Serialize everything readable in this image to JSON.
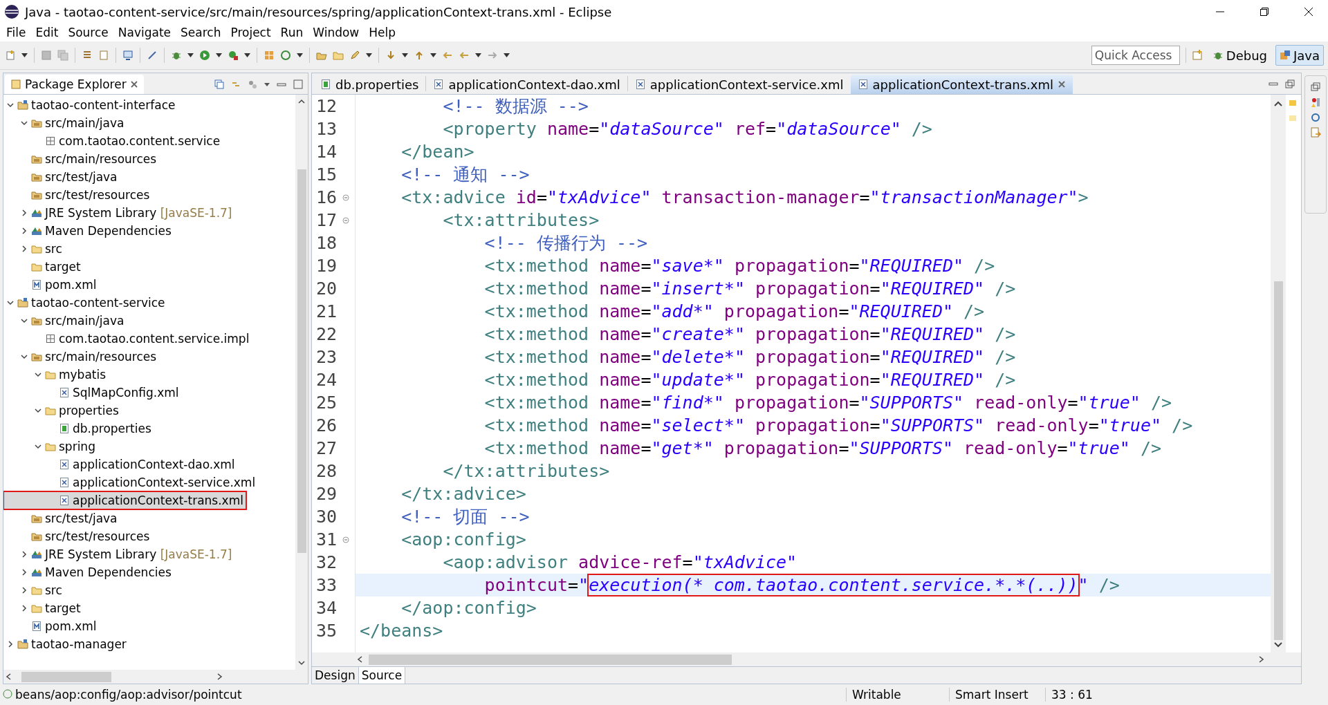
{
  "window": {
    "title": "Java - taotao-content-service/src/main/resources/spring/applicationContext-trans.xml - Eclipse"
  },
  "menu": [
    "File",
    "Edit",
    "Source",
    "Navigate",
    "Search",
    "Project",
    "Run",
    "Window",
    "Help"
  ],
  "quick_access": {
    "placeholder": "Quick Access"
  },
  "perspectives": [
    {
      "label": "Debug",
      "kind": "debug",
      "selected": false
    },
    {
      "label": "Java",
      "kind": "java",
      "selected": true
    }
  ],
  "package_explorer": {
    "title": "Package Explorer",
    "tree": [
      {
        "label": "taotao-content-interface",
        "kind": "project",
        "expanded": true,
        "selected": false,
        "children": [
          {
            "label": "src/main/java",
            "kind": "source",
            "expanded": true,
            "selected": false,
            "children": [
              {
                "label": "com.taotao.content.service",
                "kind": "package",
                "selected": false
              }
            ]
          },
          {
            "label": "src/main/resources",
            "kind": "source",
            "selected": false
          },
          {
            "label": "src/test/java",
            "kind": "source",
            "selected": false
          },
          {
            "label": "src/test/resources",
            "kind": "source",
            "selected": false
          },
          {
            "label": "JRE System Library",
            "decoration": "[JavaSE-1.7]",
            "kind": "library",
            "expanded": false,
            "selected": false
          },
          {
            "label": "Maven Dependencies",
            "kind": "library",
            "expanded": false,
            "selected": false
          },
          {
            "label": "src",
            "kind": "folder",
            "expanded": false,
            "selected": false
          },
          {
            "label": "target",
            "kind": "folder",
            "selected": false
          },
          {
            "label": "pom.xml",
            "kind": "pom",
            "selected": false
          }
        ]
      },
      {
        "label": "taotao-content-service",
        "kind": "project",
        "expanded": true,
        "selected": false,
        "children": [
          {
            "label": "src/main/java",
            "kind": "source",
            "expanded": true,
            "selected": false,
            "children": [
              {
                "label": "com.taotao.content.service.impl",
                "kind": "package",
                "selected": false
              }
            ]
          },
          {
            "label": "src/main/resources",
            "kind": "source",
            "expanded": true,
            "selected": false,
            "children": [
              {
                "label": "mybatis",
                "kind": "folder",
                "expanded": true,
                "selected": false,
                "children": [
                  {
                    "label": "SqlMapConfig.xml",
                    "kind": "xml",
                    "selected": false
                  }
                ]
              },
              {
                "label": "properties",
                "kind": "folder",
                "expanded": true,
                "selected": false,
                "children": [
                  {
                    "label": "db.properties",
                    "kind": "properties",
                    "selected": false
                  }
                ]
              },
              {
                "label": "spring",
                "kind": "folder",
                "expanded": true,
                "selected": false,
                "children": [
                  {
                    "label": "applicationContext-dao.xml",
                    "kind": "xml",
                    "selected": false
                  },
                  {
                    "label": "applicationContext-service.xml",
                    "kind": "xml",
                    "selected": false
                  },
                  {
                    "label": "applicationContext-trans.xml",
                    "kind": "xml",
                    "selected": true
                  }
                ]
              }
            ]
          },
          {
            "label": "src/test/java",
            "kind": "source",
            "selected": false
          },
          {
            "label": "src/test/resources",
            "kind": "source",
            "selected": false
          },
          {
            "label": "JRE System Library",
            "decoration": "[JavaSE-1.7]",
            "kind": "library",
            "expanded": false,
            "selected": false
          },
          {
            "label": "Maven Dependencies",
            "kind": "library",
            "expanded": false,
            "selected": false
          },
          {
            "label": "src",
            "kind": "folder",
            "expanded": false,
            "selected": false
          },
          {
            "label": "target",
            "kind": "folder",
            "expanded": false,
            "selected": false
          },
          {
            "label": "pom.xml",
            "kind": "pom",
            "selected": false
          }
        ]
      },
      {
        "label": "taotao-manager",
        "kind": "project",
        "expanded": false,
        "selected": false
      }
    ]
  },
  "editor": {
    "tabs": [
      {
        "label": "db.properties",
        "kind": "properties",
        "selected": false
      },
      {
        "label": "applicationContext-dao.xml",
        "kind": "xml",
        "selected": false
      },
      {
        "label": "applicationContext-service.xml",
        "kind": "xml",
        "selected": false
      },
      {
        "label": "applicationContext-trans.xml",
        "kind": "xml",
        "selected": true
      }
    ],
    "lines": [
      {
        "number": "12",
        "fold": false,
        "current": false,
        "tokens": [
          {
            "kind": "comment",
            "text": "        <!-- 数据源 -->"
          }
        ]
      },
      {
        "number": "13",
        "fold": false,
        "current": false,
        "tokens": [
          {
            "kind": "tag",
            "text": "        <property "
          },
          {
            "kind": "attr",
            "text": "name"
          },
          {
            "kind": "text",
            "text": "="
          },
          {
            "kind": "value",
            "text": "\"dataSource\""
          },
          {
            "kind": "attr",
            "text": " ref"
          },
          {
            "kind": "text",
            "text": "="
          },
          {
            "kind": "value",
            "text": "\"dataSource\""
          },
          {
            "kind": "tag",
            "text": " />"
          }
        ]
      },
      {
        "number": "14",
        "fold": false,
        "current": false,
        "tokens": [
          {
            "kind": "tag",
            "text": "    </bean>"
          }
        ]
      },
      {
        "number": "15",
        "fold": false,
        "current": false,
        "tokens": [
          {
            "kind": "comment",
            "text": "    <!-- 通知 -->"
          }
        ]
      },
      {
        "number": "16",
        "fold": true,
        "current": false,
        "tokens": [
          {
            "kind": "tag",
            "text": "    <tx:advice "
          },
          {
            "kind": "attr",
            "text": "id"
          },
          {
            "kind": "text",
            "text": "="
          },
          {
            "kind": "value",
            "text": "\"txAdvice\""
          },
          {
            "kind": "attr",
            "text": " transaction-manager"
          },
          {
            "kind": "text",
            "text": "="
          },
          {
            "kind": "value",
            "text": "\"transactionManager\""
          },
          {
            "kind": "tag",
            "text": ">"
          }
        ]
      },
      {
        "number": "17",
        "fold": true,
        "current": false,
        "tokens": [
          {
            "kind": "tag",
            "text": "        <tx:attributes>"
          }
        ]
      },
      {
        "number": "18",
        "fold": false,
        "current": false,
        "tokens": [
          {
            "kind": "comment",
            "text": "            <!-- 传播行为 -->"
          }
        ]
      },
      {
        "number": "19",
        "fold": false,
        "current": false,
        "tokens": [
          {
            "kind": "tag",
            "text": "            <tx:method "
          },
          {
            "kind": "attr",
            "text": "name"
          },
          {
            "kind": "text",
            "text": "="
          },
          {
            "kind": "value",
            "text": "\"save*\""
          },
          {
            "kind": "attr",
            "text": " propagation"
          },
          {
            "kind": "text",
            "text": "="
          },
          {
            "kind": "value",
            "text": "\"REQUIRED\""
          },
          {
            "kind": "tag",
            "text": " />"
          }
        ]
      },
      {
        "number": "20",
        "fold": false,
        "current": false,
        "tokens": [
          {
            "kind": "tag",
            "text": "            <tx:method "
          },
          {
            "kind": "attr",
            "text": "name"
          },
          {
            "kind": "text",
            "text": "="
          },
          {
            "kind": "value",
            "text": "\"insert*\""
          },
          {
            "kind": "attr",
            "text": " propagation"
          },
          {
            "kind": "text",
            "text": "="
          },
          {
            "kind": "value",
            "text": "\"REQUIRED\""
          },
          {
            "kind": "tag",
            "text": " />"
          }
        ]
      },
      {
        "number": "21",
        "fold": false,
        "current": false,
        "tokens": [
          {
            "kind": "tag",
            "text": "            <tx:method "
          },
          {
            "kind": "attr",
            "text": "name"
          },
          {
            "kind": "text",
            "text": "="
          },
          {
            "kind": "value",
            "text": "\"add*\""
          },
          {
            "kind": "attr",
            "text": " propagation"
          },
          {
            "kind": "text",
            "text": "="
          },
          {
            "kind": "value",
            "text": "\"REQUIRED\""
          },
          {
            "kind": "tag",
            "text": " />"
          }
        ]
      },
      {
        "number": "22",
        "fold": false,
        "current": false,
        "tokens": [
          {
            "kind": "tag",
            "text": "            <tx:method "
          },
          {
            "kind": "attr",
            "text": "name"
          },
          {
            "kind": "text",
            "text": "="
          },
          {
            "kind": "value",
            "text": "\"create*\""
          },
          {
            "kind": "attr",
            "text": " propagation"
          },
          {
            "kind": "text",
            "text": "="
          },
          {
            "kind": "value",
            "text": "\"REQUIRED\""
          },
          {
            "kind": "tag",
            "text": " />"
          }
        ]
      },
      {
        "number": "23",
        "fold": false,
        "current": false,
        "tokens": [
          {
            "kind": "tag",
            "text": "            <tx:method "
          },
          {
            "kind": "attr",
            "text": "name"
          },
          {
            "kind": "text",
            "text": "="
          },
          {
            "kind": "value",
            "text": "\"delete*\""
          },
          {
            "kind": "attr",
            "text": " propagation"
          },
          {
            "kind": "text",
            "text": "="
          },
          {
            "kind": "value",
            "text": "\"REQUIRED\""
          },
          {
            "kind": "tag",
            "text": " />"
          }
        ]
      },
      {
        "number": "24",
        "fold": false,
        "current": false,
        "tokens": [
          {
            "kind": "tag",
            "text": "            <tx:method "
          },
          {
            "kind": "attr",
            "text": "name"
          },
          {
            "kind": "text",
            "text": "="
          },
          {
            "kind": "value",
            "text": "\"update*\""
          },
          {
            "kind": "attr",
            "text": " propagation"
          },
          {
            "kind": "text",
            "text": "="
          },
          {
            "kind": "value",
            "text": "\"REQUIRED\""
          },
          {
            "kind": "tag",
            "text": " />"
          }
        ]
      },
      {
        "number": "25",
        "fold": false,
        "current": false,
        "tokens": [
          {
            "kind": "tag",
            "text": "            <tx:method "
          },
          {
            "kind": "attr",
            "text": "name"
          },
          {
            "kind": "text",
            "text": "="
          },
          {
            "kind": "value",
            "text": "\"find*\""
          },
          {
            "kind": "attr",
            "text": " propagation"
          },
          {
            "kind": "text",
            "text": "="
          },
          {
            "kind": "value",
            "text": "\"SUPPORTS\""
          },
          {
            "kind": "attr",
            "text": " read-only"
          },
          {
            "kind": "text",
            "text": "="
          },
          {
            "kind": "value",
            "text": "\"true\""
          },
          {
            "kind": "tag",
            "text": " />"
          }
        ]
      },
      {
        "number": "26",
        "fold": false,
        "current": false,
        "tokens": [
          {
            "kind": "tag",
            "text": "            <tx:method "
          },
          {
            "kind": "attr",
            "text": "name"
          },
          {
            "kind": "text",
            "text": "="
          },
          {
            "kind": "value",
            "text": "\"select*\""
          },
          {
            "kind": "attr",
            "text": " propagation"
          },
          {
            "kind": "text",
            "text": "="
          },
          {
            "kind": "value",
            "text": "\"SUPPORTS\""
          },
          {
            "kind": "attr",
            "text": " read-only"
          },
          {
            "kind": "text",
            "text": "="
          },
          {
            "kind": "value",
            "text": "\"true\""
          },
          {
            "kind": "tag",
            "text": " />"
          }
        ]
      },
      {
        "number": "27",
        "fold": false,
        "current": false,
        "tokens": [
          {
            "kind": "tag",
            "text": "            <tx:method "
          },
          {
            "kind": "attr",
            "text": "name"
          },
          {
            "kind": "text",
            "text": "="
          },
          {
            "kind": "value",
            "text": "\"get*\""
          },
          {
            "kind": "attr",
            "text": " propagation"
          },
          {
            "kind": "text",
            "text": "="
          },
          {
            "kind": "value",
            "text": "\"SUPPORTS\""
          },
          {
            "kind": "attr",
            "text": " read-only"
          },
          {
            "kind": "text",
            "text": "="
          },
          {
            "kind": "value",
            "text": "\"true\""
          },
          {
            "kind": "tag",
            "text": " />"
          }
        ]
      },
      {
        "number": "28",
        "fold": false,
        "current": false,
        "tokens": [
          {
            "kind": "tag",
            "text": "        </tx:attributes>"
          }
        ]
      },
      {
        "number": "29",
        "fold": false,
        "current": false,
        "tokens": [
          {
            "kind": "tag",
            "text": "    </tx:advice>"
          }
        ]
      },
      {
        "number": "30",
        "fold": false,
        "current": false,
        "tokens": [
          {
            "kind": "comment",
            "text": "    <!-- 切面 -->"
          }
        ]
      },
      {
        "number": "31",
        "fold": true,
        "current": false,
        "tokens": [
          {
            "kind": "tag",
            "text": "    <aop:config>"
          }
        ]
      },
      {
        "number": "32",
        "fold": false,
        "current": false,
        "tokens": [
          {
            "kind": "tag",
            "text": "        <aop:advisor "
          },
          {
            "kind": "attr",
            "text": "advice-ref"
          },
          {
            "kind": "text",
            "text": "="
          },
          {
            "kind": "value",
            "text": "\"txAdvice\""
          }
        ]
      },
      {
        "number": "33",
        "fold": false,
        "current": true,
        "tokens": [
          {
            "kind": "attr",
            "text": "            pointcut"
          },
          {
            "kind": "text",
            "text": "="
          },
          {
            "kind": "value",
            "text": "\""
          },
          {
            "kind": "value",
            "text": "execution(* com.taotao.content.service.*.*(..))",
            "boxed": true
          },
          {
            "kind": "value",
            "text": "\""
          },
          {
            "kind": "tag",
            "text": " />"
          }
        ]
      },
      {
        "number": "34",
        "fold": false,
        "current": false,
        "tokens": [
          {
            "kind": "tag",
            "text": "    </aop:config>"
          }
        ]
      },
      {
        "number": "35",
        "fold": false,
        "current": false,
        "tokens": [
          {
            "kind": "tag",
            "text": "</beans>"
          }
        ]
      }
    ],
    "bottom_tabs": [
      {
        "label": "Design",
        "selected": false
      },
      {
        "label": "Source",
        "selected": true
      }
    ]
  },
  "status_bar": {
    "path": "beans/aop:config/aop:advisor/pointcut",
    "mode": "Writable",
    "insert_mode": "Smart Insert",
    "position": "33 : 61"
  }
}
